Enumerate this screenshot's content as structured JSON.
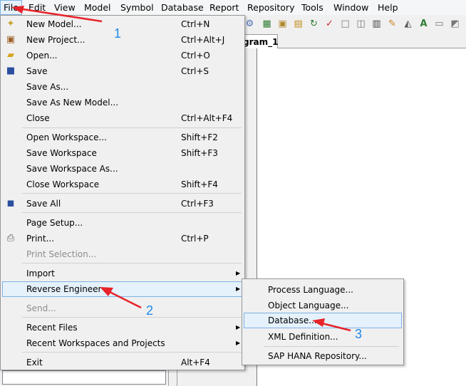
{
  "menubar": {
    "items": [
      "File",
      "Edit",
      "View",
      "Model",
      "Symbol",
      "Database",
      "Report",
      "Repository",
      "Tools",
      "Window",
      "Help"
    ]
  },
  "diagram": {
    "tab_label": "gram_1"
  },
  "file_menu": {
    "items": [
      {
        "label": "New Model...",
        "shortcut": "Ctrl+N",
        "icon": "new-model-icon"
      },
      {
        "label": "New Project...",
        "shortcut": "Ctrl+Alt+J",
        "icon": "new-project-icon"
      },
      {
        "label": "Open...",
        "shortcut": "Ctrl+O",
        "icon": "open-folder-icon"
      },
      {
        "label": "Save",
        "shortcut": "Ctrl+S",
        "icon": "save-disk-icon"
      },
      {
        "label": "Save As...",
        "shortcut": ""
      },
      {
        "label": "Save As New Model...",
        "shortcut": ""
      },
      {
        "label": "Close",
        "shortcut": "Ctrl+Alt+F4"
      },
      {
        "label": "Open Workspace...",
        "shortcut": "Shift+F2"
      },
      {
        "label": "Save Workspace",
        "shortcut": "Shift+F3"
      },
      {
        "label": "Save Workspace As...",
        "shortcut": ""
      },
      {
        "label": "Close Workspace",
        "shortcut": "Shift+F4"
      },
      {
        "label": "Save All",
        "shortcut": "Ctrl+F3",
        "icon": "save-all-icon"
      },
      {
        "label": "Page Setup...",
        "shortcut": ""
      },
      {
        "label": "Print...",
        "shortcut": "Ctrl+P",
        "icon": "printer-icon"
      },
      {
        "label": "Print Selection...",
        "shortcut": "",
        "disabled": true
      },
      {
        "label": "Import",
        "shortcut": "",
        "submenu": true
      },
      {
        "label": "Reverse Engineer",
        "shortcut": "",
        "submenu": true,
        "highlighted": true
      },
      {
        "label": "Send...",
        "shortcut": "",
        "disabled": true
      },
      {
        "label": "Recent Files",
        "shortcut": "",
        "submenu": true
      },
      {
        "label": "Recent Workspaces and Projects",
        "shortcut": "",
        "submenu": true
      },
      {
        "label": "Exit",
        "shortcut": "Alt+F4"
      }
    ]
  },
  "reverse_engineer_menu": {
    "items": [
      {
        "label": "Process Language..."
      },
      {
        "label": "Object Language..."
      },
      {
        "label": "Database...",
        "highlighted": true
      },
      {
        "label": "XML Definition..."
      },
      {
        "label": "SAP HANA Repository..."
      }
    ]
  },
  "annotations": [
    "1",
    "2",
    "3"
  ],
  "colors": {
    "arrow": "#e8232a",
    "number": "#1e88e5",
    "highlight": "#e5f1fb",
    "highlight_border": "#7fb2e5"
  }
}
